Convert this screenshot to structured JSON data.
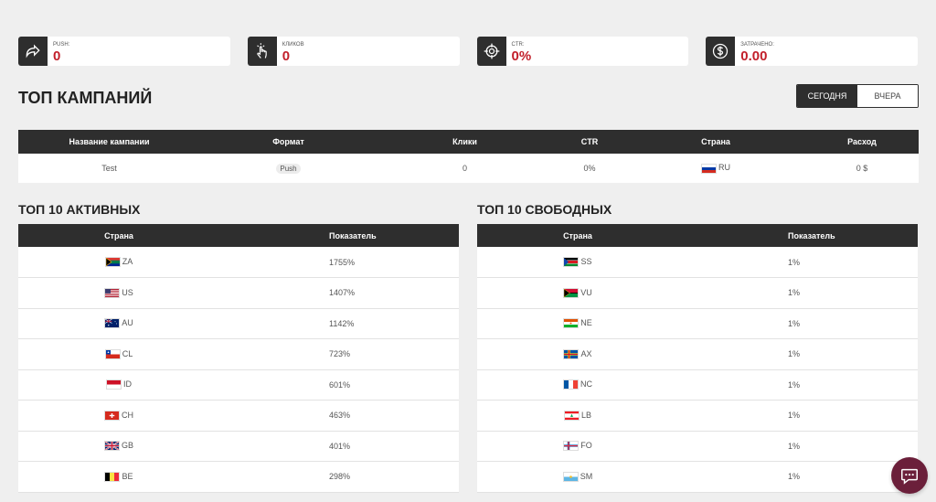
{
  "stats": [
    {
      "label": "PUSH:",
      "value": "0",
      "icon": "share-arrow-icon"
    },
    {
      "label": "КЛИКОВ",
      "value": "0",
      "icon": "tap-icon"
    },
    {
      "label": "CTR:",
      "value": "0%",
      "icon": "target-icon"
    },
    {
      "label": "ЗАТРАЧЕНО:",
      "value": "0.00",
      "icon": "dollar-coin-icon"
    }
  ],
  "page_title": "ТОП КАМПАНИЙ",
  "range": {
    "today": "СЕГОДНЯ",
    "yesterday": "ВЧЕРА"
  },
  "campaigns": {
    "headers": [
      "Название кампании",
      "Формат",
      "Клики",
      "CTR",
      "Страна",
      "Расход"
    ],
    "rows": [
      {
        "name": "Test",
        "format": "Push",
        "clicks": "0",
        "ctr": "0%",
        "country": "RU",
        "spend": "0 $"
      }
    ]
  },
  "top_active": {
    "title": "ТОП 10 АКТИВНЫХ",
    "headers": [
      "Страна",
      "Показатель"
    ],
    "rows": [
      {
        "country": "ZA",
        "value": "1755%"
      },
      {
        "country": "US",
        "value": "1407%"
      },
      {
        "country": "AU",
        "value": "1142%"
      },
      {
        "country": "CL",
        "value": "723%"
      },
      {
        "country": "ID",
        "value": "601%"
      },
      {
        "country": "CH",
        "value": "463%"
      },
      {
        "country": "GB",
        "value": "401%"
      },
      {
        "country": "BE",
        "value": "298%"
      }
    ]
  },
  "top_free": {
    "title": "ТОП 10 СВОБОДНЫХ",
    "headers": [
      "Страна",
      "Показатель"
    ],
    "rows": [
      {
        "country": "SS",
        "value": "1%"
      },
      {
        "country": "VU",
        "value": "1%"
      },
      {
        "country": "NE",
        "value": "1%"
      },
      {
        "country": "AX",
        "value": "1%"
      },
      {
        "country": "NC",
        "value": "1%"
      },
      {
        "country": "LB",
        "value": "1%"
      },
      {
        "country": "FO",
        "value": "1%"
      },
      {
        "country": "SM",
        "value": "1%"
      }
    ]
  },
  "colors": {
    "accent": "#c21f2a",
    "dark": "#2e2e2e",
    "chat": "#6b1f3a"
  }
}
